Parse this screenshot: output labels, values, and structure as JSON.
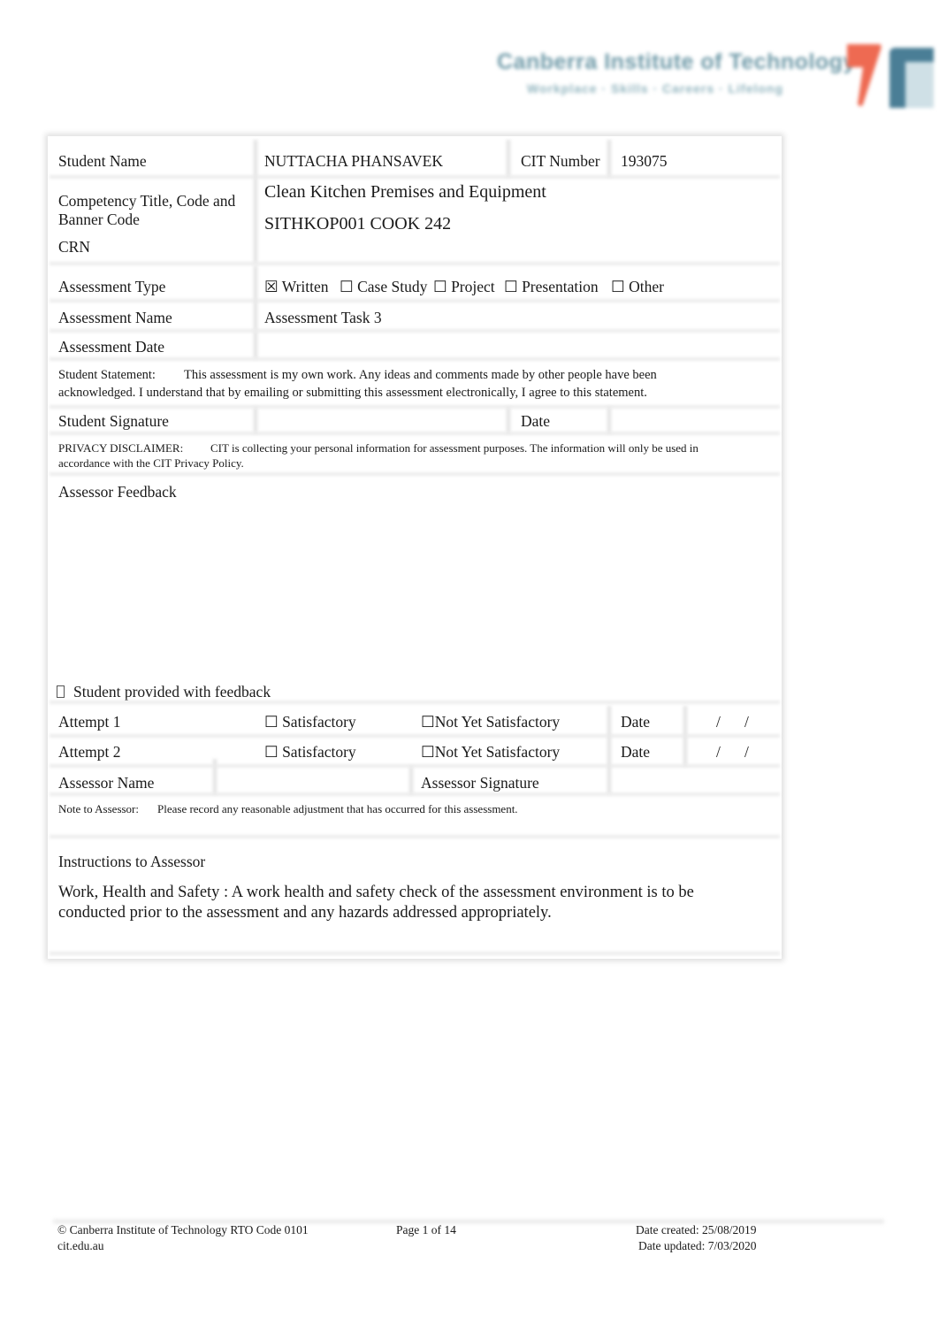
{
  "header": {
    "logo": {
      "name": "Canberra Institute of Technology",
      "tagline": "Workplace · Skills · Careers · Lifelong",
      "colors": {
        "red": "#ee6a52",
        "blue": "#4a7e96",
        "text": "#6f9aa8"
      }
    }
  },
  "form": {
    "student_name": {
      "label": "Student Name",
      "value": "NUTTACHA PHANSAVEK"
    },
    "cit_number": {
      "label": "CIT Number",
      "value": "193075"
    },
    "competency": {
      "label_line1": "Competency Title, Code and",
      "label_line2": "Banner Code",
      "crn_label": "CRN",
      "title": "Clean Kitchen Premises and Equipment",
      "code": "SITHKOP001 COOK 242"
    },
    "assessment_type": {
      "label": "Assessment Type",
      "options": [
        {
          "label": "Written",
          "checked": true,
          "box": "☒"
        },
        {
          "label": "Case Study",
          "checked": false,
          "box": "☐"
        },
        {
          "label": "Project",
          "checked": false,
          "box": "☐"
        },
        {
          "label": "Presentation",
          "checked": false,
          "box": "☐"
        },
        {
          "label": "Other",
          "checked": false,
          "box": "☐"
        }
      ]
    },
    "assessment_name": {
      "label": "Assessment Name",
      "value": "Assessment Task 3"
    },
    "assessment_date": {
      "label": "Assessment Date",
      "value": ""
    },
    "student_statement": {
      "label": "Student Statement:",
      "line1": "This assessment is my own work.  Any ideas and comments made by other people have been",
      "line2": "acknowledged.  I understand that by emailing or submitting this assessment electronically, I agree to this statement."
    },
    "student_signature": {
      "label": "Student Signature",
      "value": "",
      "date_label": "Date",
      "date_value": ""
    },
    "privacy": {
      "label": "PRIVACY DISCLAIMER:",
      "line1": "CIT is collecting your personal information for assessment purposes. The information will only be used in",
      "line2": "accordance with the CIT Privacy Policy."
    },
    "assessor_feedback": {
      "label": "Assessor Feedback",
      "value": ""
    },
    "feedback_provided": {
      "box": "",
      "label": "Student provided with feedback",
      "checked": false
    },
    "attempts": [
      {
        "label": "Attempt 1",
        "satisfactory": "Satisfactory",
        "not_yet": "Not Yet Satisfactory",
        "box": "☐",
        "date_label": "Date",
        "slash1": "/",
        "slash2": "/"
      },
      {
        "label": "Attempt 2",
        "satisfactory": "Satisfactory",
        "not_yet": "Not Yet Satisfactory",
        "box": "☐",
        "date_label": "Date",
        "slash1": "/",
        "slash2": "/"
      }
    ],
    "assessor_name": {
      "label": "Assessor Name",
      "value": ""
    },
    "assessor_signature": {
      "label": "Assessor Signature",
      "value": ""
    },
    "note_to_assessor": {
      "label": "Note to Assessor:",
      "text": "Please record any reasonable adjustment that has occurred for this assessment."
    },
    "instructions": {
      "title": "Instructions to Assessor",
      "line1": "Work, Health and Safety : A work health and safety check of the assessment environment is to be",
      "line2": "conducted prior to the assessment and any hazards addressed appropriately."
    }
  },
  "footer": {
    "copyright": "© Canberra Institute of Technology RTO Code 0101",
    "website": "cit.edu.au",
    "page": "Page 1 of 14",
    "date_created": "Date created: 25/08/2019",
    "date_updated": "Date updated: 7/03/2020"
  }
}
